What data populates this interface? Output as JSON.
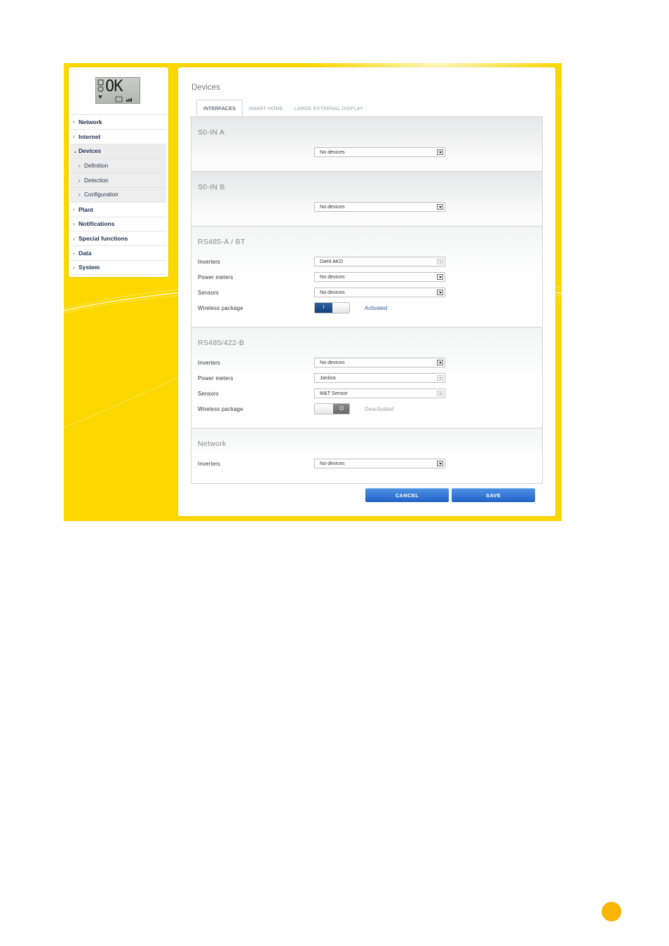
{
  "lcd": {
    "text": "OK"
  },
  "sidebar": {
    "items": [
      {
        "label": "Network",
        "level": 0,
        "chevron": "›"
      },
      {
        "label": "Internet",
        "level": 0,
        "chevron": "›"
      },
      {
        "label": "Devices",
        "level": 0,
        "chevron": "⌄",
        "expanded": true
      },
      {
        "label": "Definition",
        "level": 1,
        "chevron": "›"
      },
      {
        "label": "Detection",
        "level": 1,
        "chevron": "›"
      },
      {
        "label": "Configuration",
        "level": 1,
        "chevron": "›"
      },
      {
        "label": "Plant",
        "level": 0,
        "chevron": "›"
      },
      {
        "label": "Notifications",
        "level": 0,
        "chevron": "›"
      },
      {
        "label": "Special functions",
        "level": 0,
        "chevron": "›"
      },
      {
        "label": "Data",
        "level": 0,
        "chevron": "›"
      },
      {
        "label": "System",
        "level": 0,
        "chevron": "›"
      }
    ]
  },
  "main": {
    "title": "Devices",
    "tabs": [
      {
        "label": "INTERFACES",
        "active": true
      },
      {
        "label": "SMART HOME",
        "active": false
      },
      {
        "label": "LARGE EXTERNAL DISPLAY",
        "active": false
      }
    ],
    "sections": {
      "s0a": {
        "title": "S0-IN A",
        "select": "No devices"
      },
      "s0b": {
        "title": "S0-IN B",
        "select": "No devices"
      },
      "rs485a": {
        "title": "RS485-A / BT",
        "inverters_label": "Inverters",
        "inverters_value": "Diehl AKO",
        "power_label": "Power meters",
        "power_value": "No devices",
        "sensors_label": "Sensors",
        "sensors_value": "No devices",
        "wireless_label": "Wireless package",
        "toggle_on_text": "I",
        "wireless_status": "Activated"
      },
      "rs485b": {
        "title": "RS485/422-B",
        "inverters_label": "Inverters",
        "inverters_value": "No devices",
        "power_label": "Power meters",
        "power_value": "Janitza",
        "sensors_label": "Sensors",
        "sensors_value": "M&T Sensor",
        "wireless_label": "Wireless package",
        "toggle_off_text": "O",
        "wireless_status": "Deactivated"
      },
      "network": {
        "title": "Network",
        "inverters_label": "Inverters",
        "inverters_value": "No devices"
      }
    },
    "buttons": {
      "cancel": "CANCEL",
      "save": "SAVE"
    }
  },
  "colors": {
    "frame_yellow": "#fcd800",
    "button_blue": "#2062c6",
    "activated_text": "#2a5b9c",
    "deactivated_text": "#9aa0a0",
    "page_dot": "#f8b400"
  }
}
